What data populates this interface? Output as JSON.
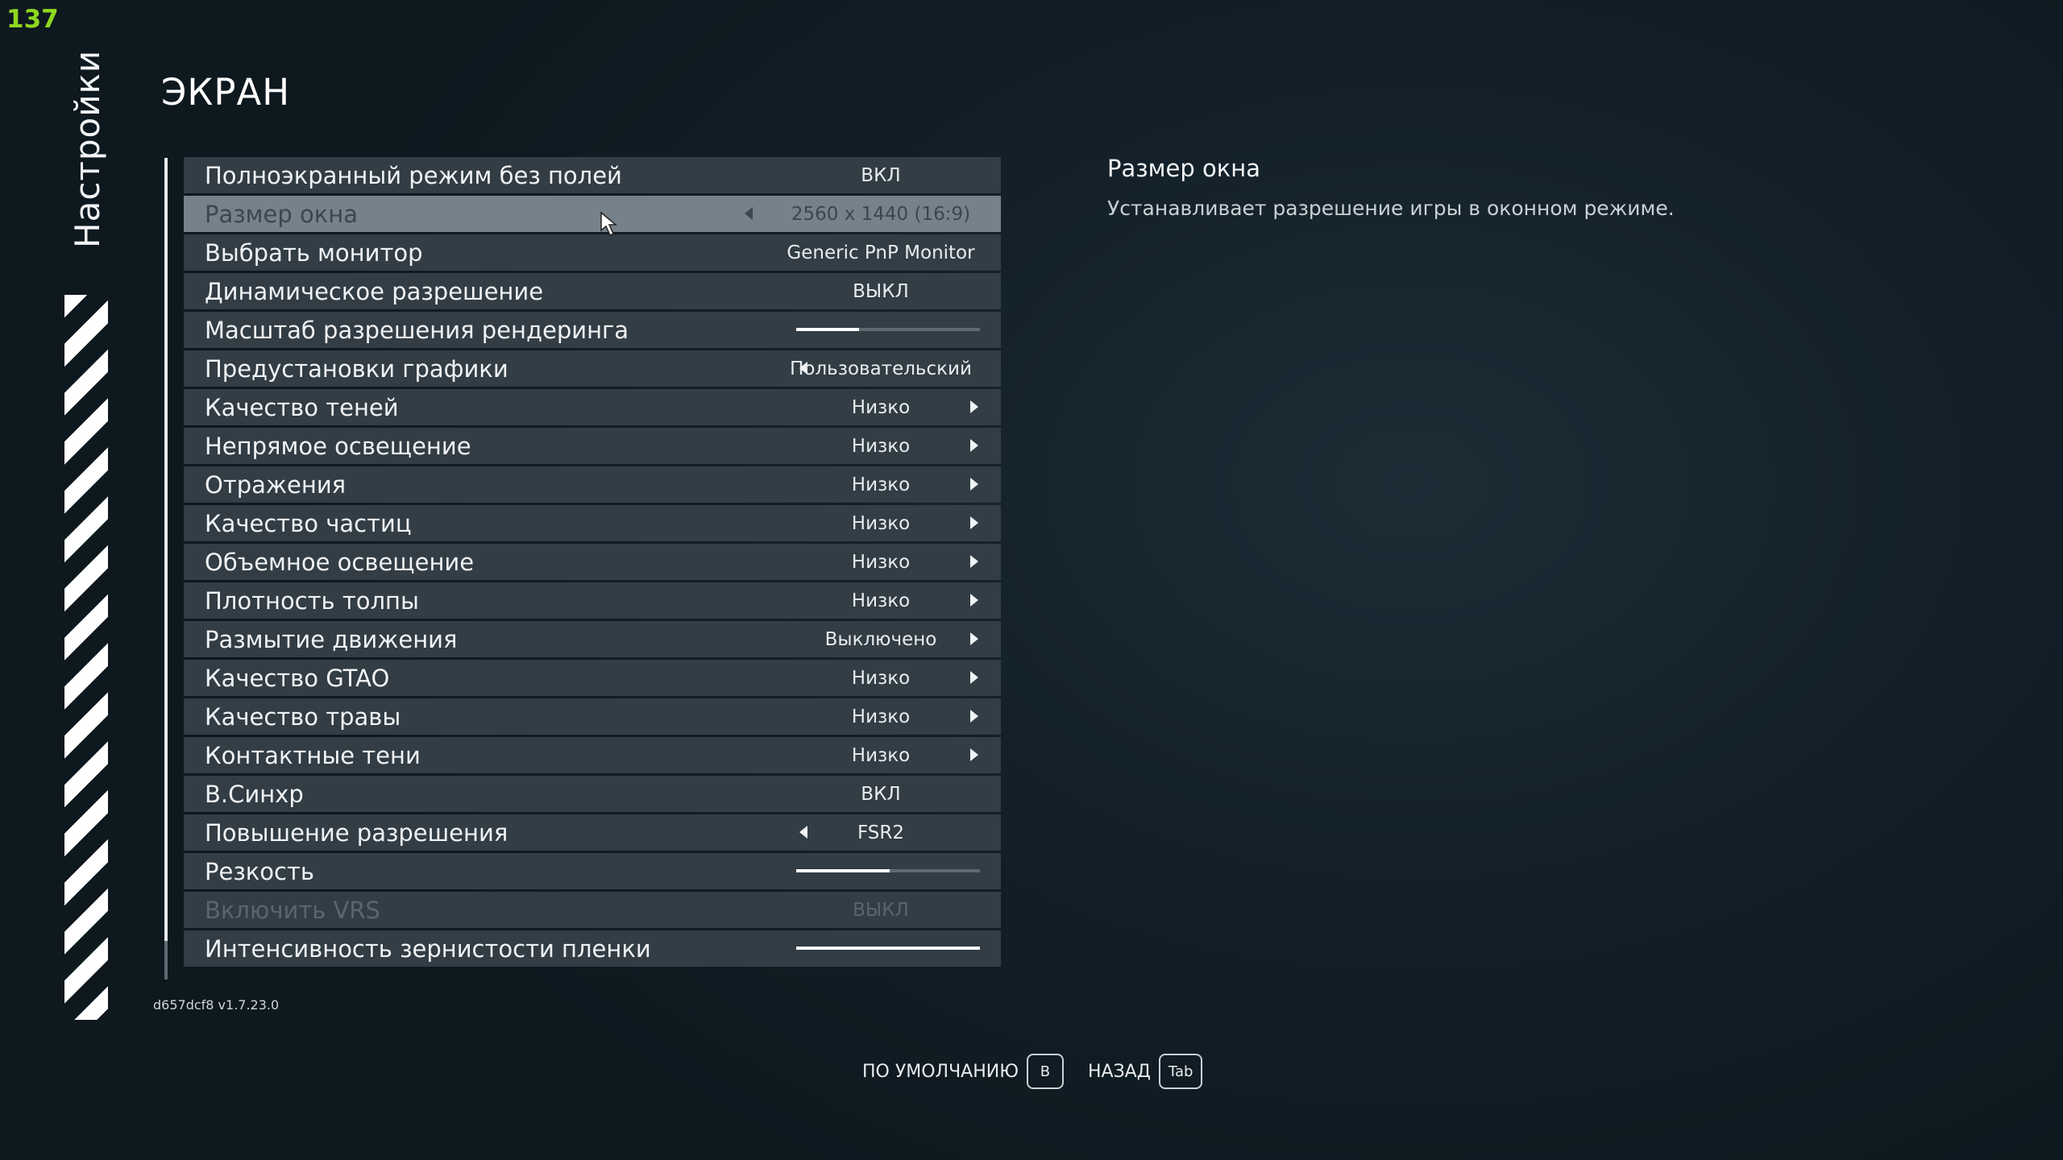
{
  "fps_counter": "137",
  "side_title": "Настройки",
  "page_title": "ЭКРАН",
  "settings": [
    {
      "label": "Полноэкранный режим без полей",
      "value": "ВКЛ",
      "control": "toggle"
    },
    {
      "label": "Размер окна",
      "value": "2560 x 1440 (16:9)",
      "control": "select",
      "state": "selected"
    },
    {
      "label": "Выбрать монитор",
      "value": "Generic PnP Monitor",
      "control": "select"
    },
    {
      "label": "Динамическое разрешение",
      "value": "ВЫКЛ",
      "control": "toggle"
    },
    {
      "label": "Масштаб разрешения рендеринга",
      "control": "slider",
      "level": 0.34
    },
    {
      "label": "Предустановки графики",
      "value": "Пользовательский",
      "control": "select"
    },
    {
      "label": "Качество теней",
      "value": "Низко",
      "control": "submenu"
    },
    {
      "label": "Непрямое освещение",
      "value": "Низко",
      "control": "submenu"
    },
    {
      "label": "Отражения",
      "value": "Низко",
      "control": "submenu"
    },
    {
      "label": "Качество частиц",
      "value": "Низко",
      "control": "submenu"
    },
    {
      "label": "Объемное освещение",
      "value": "Низко",
      "control": "submenu"
    },
    {
      "label": "Плотность толпы",
      "value": "Низко",
      "control": "submenu"
    },
    {
      "label": "Размытие движения",
      "value": "Выключено",
      "control": "submenu"
    },
    {
      "label": "Качество GTAO",
      "value": "Низко",
      "control": "submenu"
    },
    {
      "label": "Качество травы",
      "value": "Низко",
      "control": "submenu"
    },
    {
      "label": "Контактные тени",
      "value": "Низко",
      "control": "submenu"
    },
    {
      "label": "В.Синхр",
      "value": "ВКЛ",
      "control": "toggle"
    },
    {
      "label": "Повышение разрешения",
      "value": "FSR2",
      "control": "select"
    },
    {
      "label": "Резкость",
      "control": "slider",
      "level": 0.51
    },
    {
      "label": "Включить VRS",
      "value": "ВЫКЛ",
      "control": "toggle",
      "state": "disabled"
    },
    {
      "label": "Интенсивность зернистости пленки",
      "control": "slider",
      "level": 1.0
    }
  ],
  "description": {
    "title": "Размер окна",
    "text": "Устанавливает разрешение игры в оконном режиме."
  },
  "version": "d657dcf8 v1.7.23.0",
  "footer": {
    "default_label": "ПО УМОЛЧАНИЮ",
    "default_key": "B",
    "back_label": "НАЗАД",
    "back_key": "Tab"
  },
  "colors": {
    "fps": "#8ed81f",
    "row_bg": "#323d45",
    "row_selected_bg": "#76818a",
    "background": "#14212a"
  }
}
